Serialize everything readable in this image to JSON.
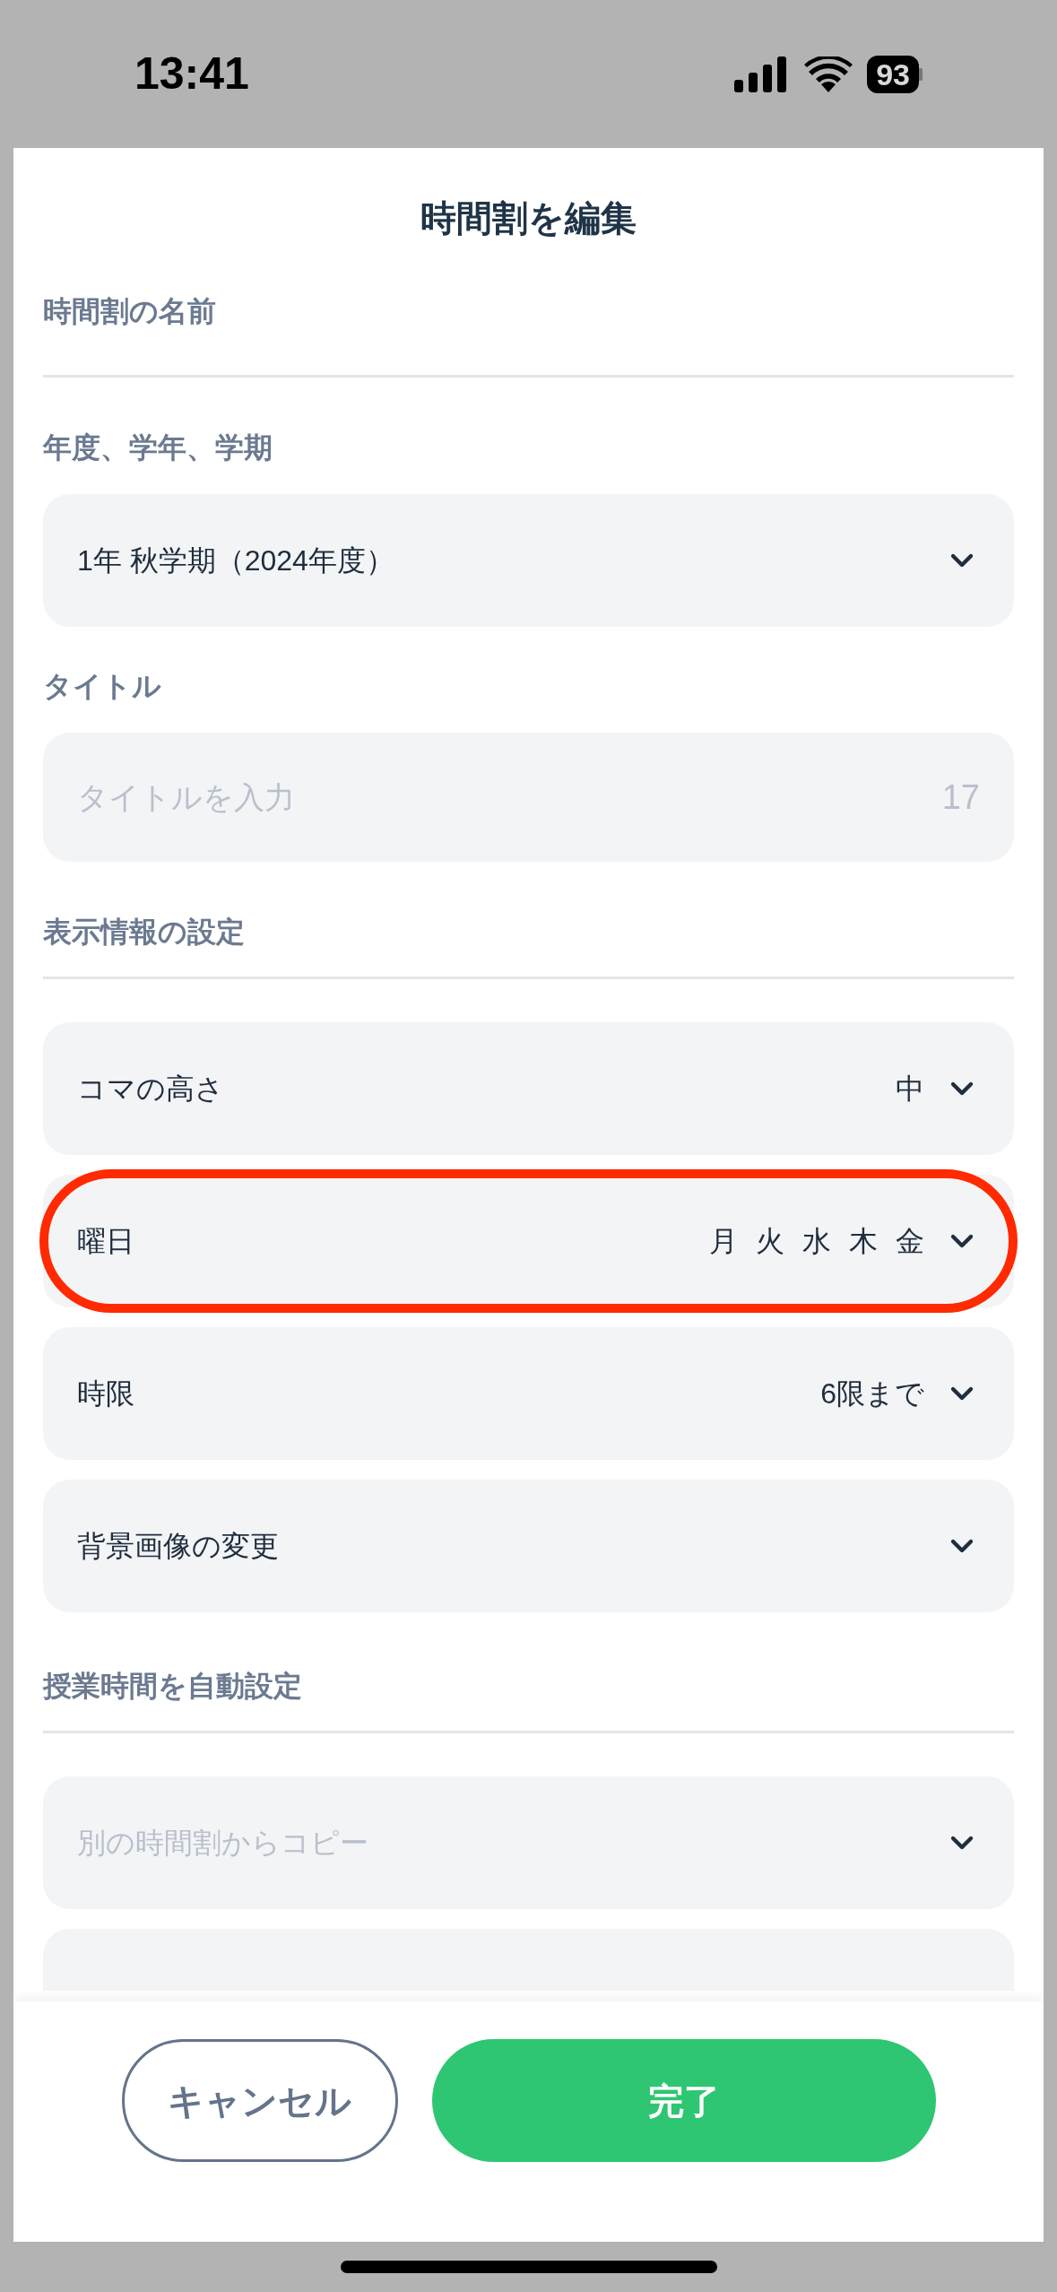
{
  "status_bar": {
    "time": "13:41",
    "battery": "93"
  },
  "title": "時間割を編集",
  "sections": [
    {
      "kind": "underline",
      "label": "時間割の名前"
    },
    {
      "kind": "select",
      "label": "年度、学年、学期",
      "rows": [
        {
          "label": "1年 秋学期（2024年度）",
          "highlighted": false
        }
      ]
    },
    {
      "kind": "text",
      "label": "タイトル",
      "placeholder": "タイトルを入力",
      "counter": "17"
    },
    {
      "kind": "group",
      "label": "表示情報の設定",
      "rows": [
        {
          "label": "コマの高さ",
          "value": "中",
          "highlighted": false
        },
        {
          "label": "曜日",
          "value": "月 火 水 木 金",
          "highlighted": true
        },
        {
          "label": "時限",
          "value": "6限まで",
          "highlighted": false
        },
        {
          "label": "背景画像の変更",
          "highlighted": false
        }
      ]
    },
    {
      "kind": "group",
      "label": "授業時間を自動設定",
      "rows": [
        {
          "placeholder": "別の時間割からコピー",
          "highlighted": false
        },
        {
          "kind": "partial",
          "highlighted": false
        }
      ]
    }
  ],
  "buttons": [
    {
      "kind": "secondary",
      "label": "キャンセル"
    },
    {
      "kind": "primary",
      "label": "完了"
    }
  ]
}
